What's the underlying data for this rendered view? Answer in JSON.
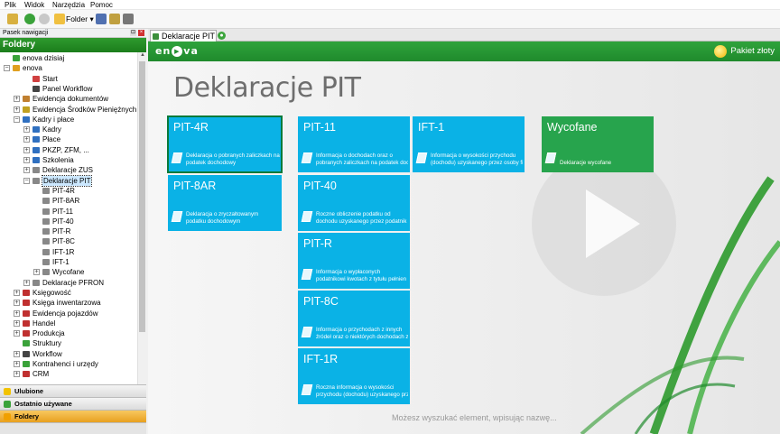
{
  "menu": {
    "items": [
      "Plik",
      "Widok",
      "Narzędzia",
      "Pomoc"
    ]
  },
  "toolbar": {
    "folder_label": "Folder"
  },
  "nav": {
    "header": "Pasek nawigacji",
    "folders_title": "Foldery"
  },
  "tree": [
    {
      "label": "enova dzisiaj",
      "indent": 0,
      "exp": "",
      "icon": "#3aa23a"
    },
    {
      "label": "enova",
      "indent": 0,
      "exp": "−",
      "icon": "#e0a020"
    },
    {
      "label": "Start",
      "indent": 2,
      "exp": "",
      "icon": "#d04040"
    },
    {
      "label": "Panel Workflow",
      "indent": 2,
      "exp": "",
      "icon": "#444"
    },
    {
      "label": "Ewidencja dokumentów",
      "indent": 1,
      "exp": "+",
      "icon": "#c08030"
    },
    {
      "label": "Ewidencja Środków Pieniężnych",
      "indent": 1,
      "exp": "+",
      "icon": "#c0a020"
    },
    {
      "label": "Kadry i płace",
      "indent": 1,
      "exp": "−",
      "icon": "#3070c0"
    },
    {
      "label": "Kadry",
      "indent": 2,
      "exp": "+",
      "icon": "#3070c0"
    },
    {
      "label": "Płace",
      "indent": 2,
      "exp": "+",
      "icon": "#3070c0"
    },
    {
      "label": "PKZP, ZFM, ...",
      "indent": 2,
      "exp": "+",
      "icon": "#3070c0"
    },
    {
      "label": "Szkolenia",
      "indent": 2,
      "exp": "+",
      "icon": "#3070c0"
    },
    {
      "label": "Deklaracje ZUS",
      "indent": 2,
      "exp": "+",
      "icon": "#888"
    },
    {
      "label": "Deklaracje PIT",
      "indent": 2,
      "exp": "−",
      "icon": "#888",
      "selected": true
    },
    {
      "label": "PIT-4R",
      "indent": 3,
      "exp": "",
      "icon": "#888"
    },
    {
      "label": "PIT-8AR",
      "indent": 3,
      "exp": "",
      "icon": "#888"
    },
    {
      "label": "PIT-11",
      "indent": 3,
      "exp": "",
      "icon": "#888"
    },
    {
      "label": "PIT-40",
      "indent": 3,
      "exp": "",
      "icon": "#888"
    },
    {
      "label": "PIT-R",
      "indent": 3,
      "exp": "",
      "icon": "#888"
    },
    {
      "label": "PIT-8C",
      "indent": 3,
      "exp": "",
      "icon": "#888"
    },
    {
      "label": "IFT-1R",
      "indent": 3,
      "exp": "",
      "icon": "#888"
    },
    {
      "label": "IFT-1",
      "indent": 3,
      "exp": "",
      "icon": "#888"
    },
    {
      "label": "Wycofane",
      "indent": 3,
      "exp": "+",
      "icon": "#888"
    },
    {
      "label": "Deklaracje PFRON",
      "indent": 2,
      "exp": "+",
      "icon": "#888"
    },
    {
      "label": "Księgowość",
      "indent": 1,
      "exp": "+",
      "icon": "#c03030"
    },
    {
      "label": "Księga inwentarzowa",
      "indent": 1,
      "exp": "+",
      "icon": "#c03030"
    },
    {
      "label": "Ewidencja pojazdów",
      "indent": 1,
      "exp": "+",
      "icon": "#c03030"
    },
    {
      "label": "Handel",
      "indent": 1,
      "exp": "+",
      "icon": "#c03030"
    },
    {
      "label": "Produkcja",
      "indent": 1,
      "exp": "+",
      "icon": "#c03030"
    },
    {
      "label": "Struktury",
      "indent": 1,
      "exp": "",
      "icon": "#3aa23a"
    },
    {
      "label": "Workflow",
      "indent": 1,
      "exp": "+",
      "icon": "#444"
    },
    {
      "label": "Kontrahenci i urzędy",
      "indent": 1,
      "exp": "+",
      "icon": "#3aa23a"
    },
    {
      "label": "CRM",
      "indent": 1,
      "exp": "+",
      "icon": "#c03030"
    }
  ],
  "leftnav": [
    {
      "label": "Ulubione",
      "color": "#f2c200"
    },
    {
      "label": "Ostatnio używane",
      "color": "#3aa23a"
    },
    {
      "label": "Foldery",
      "color": "#f0a000",
      "active": true
    }
  ],
  "tab": {
    "label": "Deklaracje PIT"
  },
  "header": {
    "logo_pre": "en",
    "logo_post": "va",
    "edition": "Pakiet złoty"
  },
  "page": {
    "title": "Deklaracje PIT",
    "hint": "Możesz wyszukać element, wpisując nazwę..."
  },
  "tiles": [
    {
      "title": "PIT-4R",
      "desc": "Deklaracja o pobranych zaliczkach na\npodatek dochodowy",
      "color": "green-border"
    },
    {
      "title": "PIT-8AR",
      "desc": "Deklaracja o zryczałtowanym\npodatku dochodowym"
    },
    {
      "title": "PIT-11",
      "desc": "Informacja o dochodach oraz o\npobranych zaliczkach na podatek doc"
    },
    {
      "title": "PIT-40",
      "desc": "Roczne obliczenie podatku od\ndochodu uzyskanego przez podatnik"
    },
    {
      "title": "PIT-R",
      "desc": "Informacja o wypłaconych\npodatnikowi kwotach z tytułu pełnien"
    },
    {
      "title": "PIT-8C",
      "desc": "Informacja o przychodach z innych\nźródeł oraz o niektórych dochodach z"
    },
    {
      "title": "IFT-1R",
      "desc": "Roczna informacja o wysokości\nprzychodu (dochodu) uzyskanego prz"
    },
    {
      "title": "IFT-1",
      "desc": "Informacja o wysokości przychodu\n(dochodu) uzyskanego przez osoby fi"
    },
    {
      "title": "Wycofane",
      "desc": "Deklaracje wycofane"
    }
  ]
}
